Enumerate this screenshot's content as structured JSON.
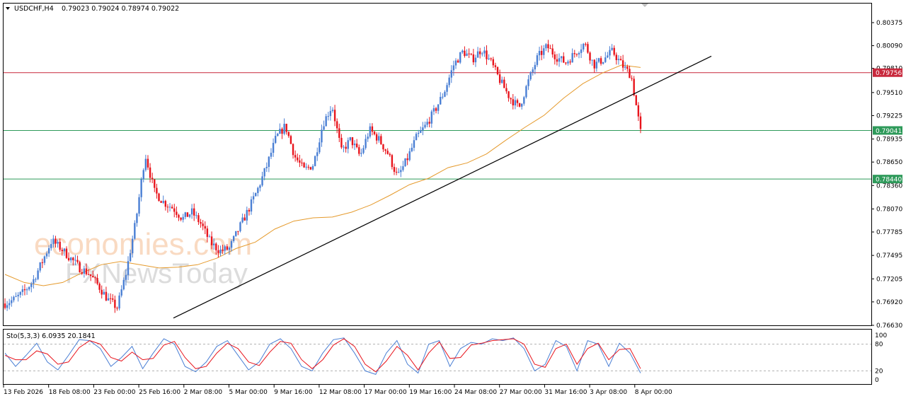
{
  "header": {
    "symbol": "USDCHF,H4",
    "ohlc": "0.79023 0.79024 0.78974 0.79022"
  },
  "oscillator": {
    "label": "Sto(5,3,3) 6.0935 20.1841",
    "scale_labels": [
      "100",
      "80",
      "20",
      "0"
    ]
  },
  "watermarks": {
    "economies": "economies.com",
    "fxnews": "FXNewsToday"
  },
  "colors": {
    "bull": "#4a7fd4",
    "bear": "#e8141c",
    "ma": "#e59a2c",
    "red_level": "#c8283c",
    "green_level": "#2e9a5a",
    "trendline": "#000000",
    "stoch_main": "#4a7fd4",
    "stoch_signal": "#e8141c"
  },
  "chart_data": {
    "type": "candlestick",
    "symbol": "USDCHF",
    "timeframe": "H4",
    "y_ticks": [
      "0.80375",
      "0.80090",
      "0.79810",
      "0.79510",
      "0.79225",
      "0.78935",
      "0.78650",
      "0.78360",
      "0.78070",
      "0.77785",
      "0.77495",
      "0.77205",
      "0.76920",
      "0.76630"
    ],
    "ylim": [
      0.7655,
      0.8068
    ],
    "x_labels": [
      "13 Feb 2026",
      "18 Feb 08:00",
      "23 Feb 00:00",
      "25 Feb 16:00",
      "2 Mar 08:00",
      "5 Mar 00:00",
      "9 Mar 16:00",
      "12 Mar 08:00",
      "17 Mar 00:00",
      "19 Mar 16:00",
      "24 Mar 08:00",
      "27 Mar 00:00",
      "31 Mar 16:00",
      "3 Apr 08:00",
      "8 Apr 00:00"
    ],
    "horizontal_levels": [
      {
        "value": 0.79756,
        "label": "0.79756",
        "color": "red"
      },
      {
        "value": 0.79041,
        "label": "0.79041",
        "color": "green"
      },
      {
        "value": 0.7844,
        "label": "0.78440",
        "color": "green"
      }
    ],
    "trendline": {
      "from": {
        "bar": 0,
        "price": 0.7672
      },
      "to": {
        "bar": 1,
        "price": 0.7996
      }
    },
    "close_path": [
      0.769,
      0.7695,
      0.7704,
      0.7718,
      0.7742,
      0.7768,
      0.7758,
      0.7746,
      0.7734,
      0.7727,
      0.7712,
      0.7695,
      0.7685,
      0.773,
      0.7792,
      0.7875,
      0.7828,
      0.7815,
      0.7808,
      0.7795,
      0.7803,
      0.7788,
      0.7765,
      0.7755,
      0.7758,
      0.7782,
      0.7805,
      0.783,
      0.786,
      0.7895,
      0.791,
      0.7872,
      0.7855,
      0.7862,
      0.7912,
      0.7935,
      0.7878,
      0.7893,
      0.7872,
      0.7905,
      0.7893,
      0.7875,
      0.7846,
      0.7868,
      0.7895,
      0.791,
      0.7929,
      0.7952,
      0.7985,
      0.8002,
      0.7992,
      0.8005,
      0.7988,
      0.7965,
      0.7945,
      0.7932,
      0.7965,
      0.7995,
      0.8008,
      0.7995,
      0.7988,
      0.8,
      0.8012,
      0.7985,
      0.7992,
      0.8002,
      0.7985,
      0.7972,
      0.7902
    ],
    "ma_path": [
      0.7726,
      0.7716,
      0.7712,
      0.7716,
      0.7728,
      0.7738,
      0.7742,
      0.7738,
      0.7734,
      0.7735,
      0.7738,
      0.7746,
      0.7758,
      0.7766,
      0.7782,
      0.7792,
      0.7796,
      0.7797,
      0.7803,
      0.7812,
      0.7824,
      0.7837,
      0.7845,
      0.7858,
      0.7864,
      0.7875,
      0.7892,
      0.7908,
      0.7923,
      0.7944,
      0.7962,
      0.7975,
      0.7985,
      0.7982
    ],
    "stochastic": {
      "main": [
        60,
        30,
        55,
        82,
        40,
        22,
        55,
        90,
        88,
        70,
        30,
        50,
        75,
        25,
        60,
        92,
        80,
        30,
        18,
        40,
        75,
        88,
        55,
        22,
        40,
        80,
        92,
        70,
        30,
        20,
        60,
        90,
        94,
        60,
        20,
        12,
        60,
        88,
        35,
        15,
        80,
        88,
        30,
        70,
        84,
        80,
        92,
        88,
        94,
        70,
        20,
        35,
        88,
        75,
        20,
        88,
        80,
        30,
        82,
        60,
        15
      ],
      "signal": [
        55,
        45,
        45,
        65,
        58,
        35,
        40,
        72,
        88,
        80,
        50,
        42,
        62,
        45,
        48,
        78,
        86,
        50,
        25,
        30,
        60,
        82,
        70,
        40,
        32,
        62,
        86,
        82,
        45,
        25,
        45,
        78,
        92,
        75,
        35,
        18,
        42,
        75,
        55,
        22,
        60,
        85,
        48,
        50,
        78,
        82,
        88,
        90,
        92,
        80,
        35,
        28,
        70,
        80,
        35,
        70,
        82,
        45,
        68,
        70,
        25
      ],
      "levels": [
        20,
        80
      ]
    }
  }
}
